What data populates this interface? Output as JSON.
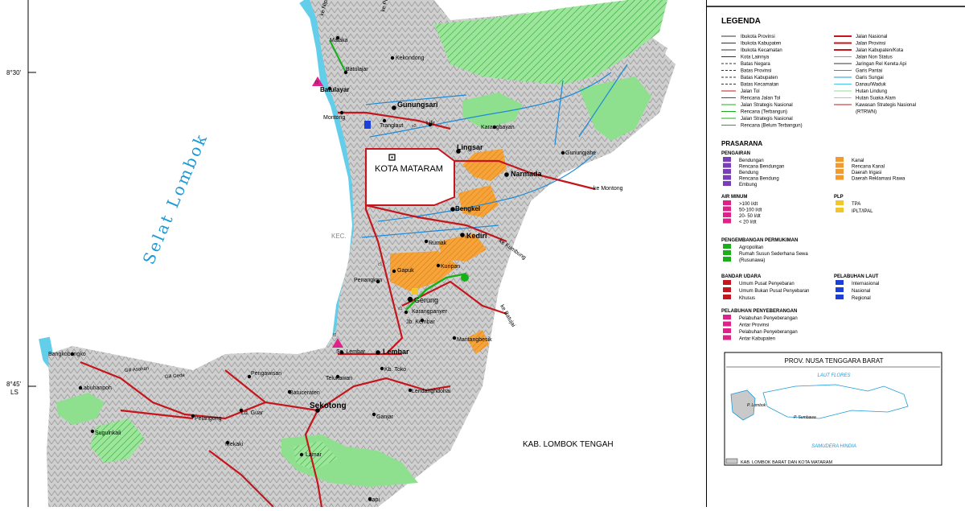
{
  "map": {
    "lat_labels": [
      "8°30'",
      "8°45'",
      "LS"
    ],
    "sea": {
      "strait": "Selat Lombok"
    },
    "region_labels": {
      "mataram": "KOTA MATARAM",
      "lombok_tengah": "KAB. LOMBOK TENGAH",
      "kec": "KEC."
    },
    "places": [
      "ke Nipah",
      "ke Pemenang",
      "Malaka",
      "Batulajar",
      "Kekondong",
      "Batulayar",
      "Gunungsari",
      "Montong",
      "Tranglaut",
      "Lilir",
      "Karangbayan",
      "Gunungjahe",
      "Lingsar",
      "Narmada",
      "ke Montong",
      "Bengkel",
      "Kediri",
      "ke Kumbung",
      "Rumak",
      "Gapuk",
      "Kuripan",
      "Penangkan",
      "Gerung",
      "ke Batujai",
      "Karangpanyer",
      "Jb. Kembar",
      "Mantangbesik",
      "Sp. Lembar",
      "Lembar",
      "Kb. Toko",
      "Telukawan",
      "Lendanghdohai",
      "Sekotong",
      "Batuceraten",
      "Pengawisan",
      "Ld. Guar",
      "Pelangong",
      "Mekaki",
      "Bangkobangko",
      "Labuhanpoh",
      "Sugulnkali",
      "Gili Asahan",
      "Gili Gede",
      "Ganjar",
      "Lamar",
      "Sapi"
    ],
    "markers": [
      "f3",
      "e2",
      "d1",
      "f2",
      "c6",
      "c1"
    ],
    "compass": "U"
  },
  "legend": {
    "title": "LEGENDA",
    "left_items": [
      "Ibukota Provinsi",
      "Ibukota Kabupaten",
      "Ibukota Kecamatan",
      "Kota Lainnya",
      "Batas Negara",
      "Batas Provinsi",
      "Batas Kabupaten",
      "Batas Kecamatan",
      "Jalan Tol",
      "Rencana Jalan Tol",
      "Jalan Strategis Nasional",
      "Rencana (Terbangun)",
      "Jalan Strategis Nasional",
      "Rencana (Belum Terbangun)"
    ],
    "right_items": [
      "Jalan Nasional",
      "Jalan Provinsi",
      "Jalan Kabupaten/Kota",
      "Jalan Non Status",
      "Jaringan Rel Kereta Api",
      "Garis Pantai",
      "Garis Sungai",
      "Danau/Waduk",
      "Hutan Lindung",
      "Hutan Suaka Alam",
      "Kawasan Strategis Nasional",
      "(RTRWN)"
    ],
    "prasarana_title": "PRASARANA",
    "pengairan_title": "PENGAIRAN",
    "pengairan_items": [
      "Bendungan",
      "Rencana Bendungan",
      "Bendung",
      "Rencana Bendung",
      "Embung"
    ],
    "pengairan_right": [
      "Kanal",
      "Rencana Kanal",
      "Daerah Irigasi",
      "Daerah Reklamasi Rawa"
    ],
    "air_minum_title": "AIR MINUM",
    "air_minum_items": [
      ">100 l/dt",
      "50-100 l/dt",
      "20- 50 l/dt",
      "< 20 l/dt"
    ],
    "plp_title": "PLP",
    "plp_items": [
      "TPA",
      "IPLT/IPAL"
    ],
    "permukiman_title": "PENGEMBANGAN PERMUKIMAN",
    "permukiman_items": [
      "Agropolitan",
      "Rumah Susun Sederhana Sewa",
      "(Rusunawa)"
    ],
    "bandar_title": "BANDAR UDARA",
    "bandar_items": [
      "Umum Pusat Penyebaran",
      "Umum Bukan Pusat Penyebaran",
      "Khusus"
    ],
    "pelabuhan_laut_title": "PELABUHAN LAUT",
    "pelabuhan_laut_items": [
      "Internasional",
      "Nasional",
      "Regional"
    ],
    "penyeberangan_title": "PELABUHAN PENYEBERANGAN",
    "penyeberangan_items": [
      "Pelabuhan Penyeberangan",
      "Antar Provinsi",
      "Pelabuhan Penyeberangan",
      "Antar Kabupaten"
    ],
    "inset": {
      "title": "PROV. NUSA TENGGARA BARAT",
      "sea_north": "LAUT FLORES",
      "sea_south": "SAMUDERA HINDIA",
      "island_1": "P. Lombok",
      "island_2": "P. Sumbawa",
      "caption": "KAB. LOMBOK BARAT DAN KOTA MATARAM"
    }
  },
  "colors": {
    "land": "#c9c9c9",
    "sea_coast": "#47c6e6",
    "forest": "#8ee08e",
    "irrigation": "#f39a2c",
    "national_road": "#c4161c",
    "strategic_road": "#18b018",
    "river": "#1b8ad8"
  }
}
